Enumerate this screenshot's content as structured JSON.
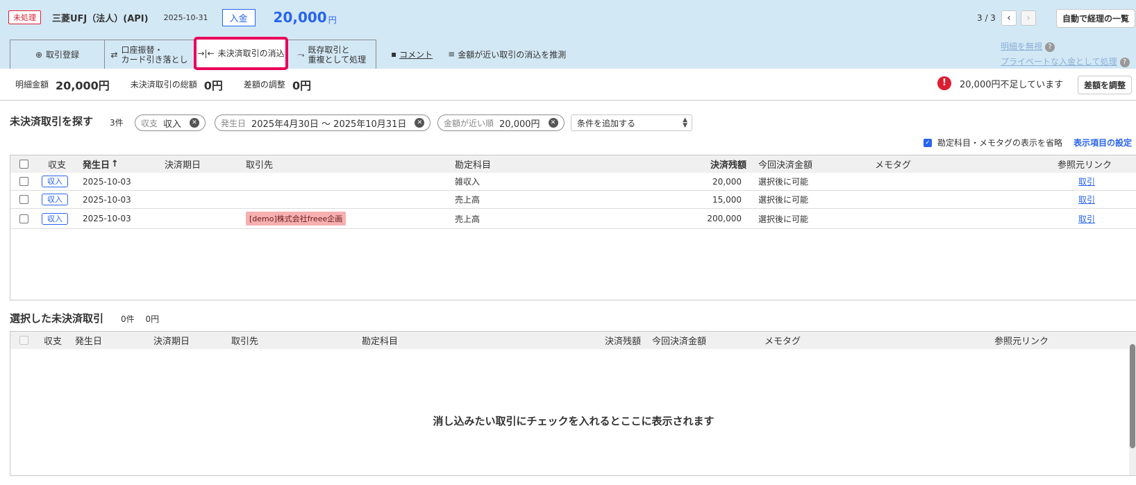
{
  "header": {
    "status_badge": "未処理",
    "bank_name": "三菱UFJ（法人）(API)",
    "date": "2025-10-31",
    "type": "入金",
    "amount": "20,000",
    "amount_unit": "円",
    "pager_text": "3 / 3",
    "prev_icon": "‹",
    "next_icon": "›",
    "auto_button": "自動で経理の一覧"
  },
  "tabs": {
    "register": "取引登録",
    "transfer_line1": "口座振替・",
    "transfer_line2": "カード引き落とし",
    "reconcile": "未決済取引の消込",
    "existing_line1": "既存取引と",
    "existing_line2": "重複として処理",
    "comment": "コメント",
    "suggest": "金額が近い取引の消込を推測"
  },
  "right_links": {
    "ignore": "明細を無視",
    "private": "プライベートな入金として処理"
  },
  "summary": {
    "detail_label": "明細金額",
    "detail_value": "20,000円",
    "total_label": "未決済取引の総額",
    "total_value": "0円",
    "diff_label": "差額の調整",
    "diff_value": "0円",
    "warning": "20,000円不足しています",
    "adjust_button": "差額を調整"
  },
  "search": {
    "title": "未決済取引を探す",
    "count": "3件",
    "chip1_key": "収支",
    "chip1_value": "収入",
    "chip2_key": "発生日",
    "chip2_value": "2025年4月30日 〜 2025年10月31日",
    "chip3_key": "金額が近い順",
    "chip3_value": "20,000円",
    "add_condition": "条件を追加する",
    "omit_label": "勘定科目・メモタグの表示を省略",
    "display_settings": "表示項目の設定"
  },
  "unsettled_table": {
    "headers": {
      "type": "収支",
      "date": "発生日",
      "sort_icon": "↑",
      "due": "決済期日",
      "partner": "取引先",
      "account": "勘定科目",
      "balance": "決済残額",
      "this_amount": "今回決済金額",
      "memo": "メモタグ",
      "ref": "参照元リンク"
    },
    "rows": [
      {
        "type": "収入",
        "date": "2025-10-03",
        "partner": "",
        "account": "雑収入",
        "balance": "20,000",
        "this_amount": "選択後に可能",
        "ref": "取引"
      },
      {
        "type": "収入",
        "date": "2025-10-03",
        "partner": "",
        "account": "売上高",
        "balance": "15,000",
        "this_amount": "選択後に可能",
        "ref": "取引"
      },
      {
        "type": "収入",
        "date": "2025-10-03",
        "partner": "[demo]株式会社freee企画",
        "account": "売上高",
        "balance": "200,000",
        "this_amount": "選択後に可能",
        "ref": "取引"
      }
    ]
  },
  "selected": {
    "title": "選択した未決済取引",
    "count": "0件",
    "sum": "0円",
    "headers": {
      "type": "収支",
      "date": "発生日",
      "due": "決済期日",
      "partner": "取引先",
      "account": "勘定科目",
      "balance": "決済残額",
      "this_amount": "今回決済金額",
      "memo": "メモタグ",
      "ref": "参照元リンク"
    },
    "empty_message": "消し込みたい取引にチェックを入れるとここに表示されます"
  }
}
